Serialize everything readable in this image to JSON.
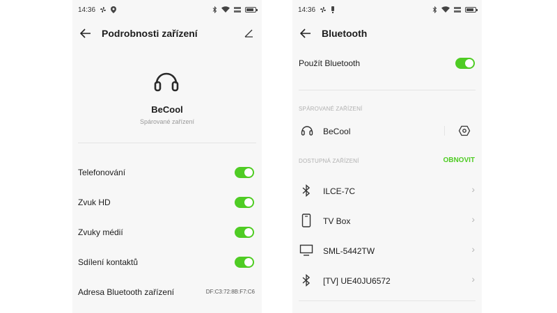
{
  "left_screen": {
    "status": {
      "time": "14:36"
    },
    "header": {
      "title": "Podrobnosti zařízení"
    },
    "device": {
      "name": "BeCool",
      "status": "Spárované zařízení"
    },
    "settings": [
      {
        "label": "Telefonování",
        "enabled": true
      },
      {
        "label": "Zvuk HD",
        "enabled": true
      },
      {
        "label": "Zvuky médií",
        "enabled": true
      },
      {
        "label": "Sdílení kontaktů",
        "enabled": true
      }
    ],
    "address": {
      "label": "Adresa Bluetooth zařízení",
      "value": "DF:C3:72:8B:F7:C6"
    }
  },
  "right_screen": {
    "status": {
      "time": "14:36"
    },
    "header": {
      "title": "Bluetooth"
    },
    "bluetooth_toggle": {
      "label": "Použít Bluetooth",
      "enabled": true
    },
    "paired_section": {
      "title": "SPÁROVANÉ ZAŘÍZENÍ",
      "devices": [
        {
          "name": "BeCool",
          "icon": "headset-icon"
        }
      ]
    },
    "available_section": {
      "title": "DOSTUPNÁ ZAŘÍZENÍ",
      "refresh_label": "OBNOVIT",
      "devices": [
        {
          "name": "ILCE-7C",
          "icon": "bluetooth-icon"
        },
        {
          "name": "TV Box",
          "icon": "phone-icon"
        },
        {
          "name": "SML-5442TW",
          "icon": "monitor-icon"
        },
        {
          "name": "[TV] UE40JU6572",
          "icon": "bluetooth-icon"
        }
      ]
    }
  },
  "colors": {
    "accent": "#4fcc24",
    "background": "#f7f7f7",
    "divider": "#e4e4e4"
  }
}
